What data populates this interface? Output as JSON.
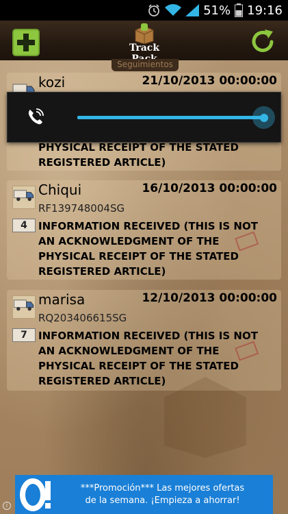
{
  "status_bar": {
    "battery": "51%",
    "time": "19:16",
    "alarm_icon": "alarm-clock-icon",
    "wifi_icon": "wifi-icon",
    "signal_icon": "signal-bars-icon",
    "battery_icon": "battery-icon"
  },
  "action_bar": {
    "title": "Track Pack",
    "subtitle": "Seguimientos",
    "add_icon": "plus-icon",
    "refresh_icon": "refresh-icon"
  },
  "items": [
    {
      "name": "kozi",
      "date": "21/10/2013 00:00:00",
      "status_visible": "PHYSICAL RECEIPT OF THE STATED\nREGISTERED ARTICLE)"
    },
    {
      "name": "Chiqui",
      "date": "16/10/2013 00:00:00",
      "code": "RF139748004SG",
      "count": "4",
      "status": "INFORMATION RECEIVED (THIS IS NOT AN ACKNOWLEDGMENT OF THE PHYSICAL RECEIPT OF THE STATED REGISTERED ARTICLE)"
    },
    {
      "name": "marisa",
      "date": "12/10/2013 00:00:00",
      "code": "RQ203406615SG",
      "count": "7",
      "status": "INFORMATION RECEIVED (THIS IS NOT AN ACKNOWLEDGMENT OF THE PHYSICAL RECEIPT OF THE STATED REGISTERED ARTICLE)"
    }
  ],
  "volume_overlay": {
    "icon": "phone-call-icon",
    "level": 1.0,
    "accent": "#33b5e5"
  },
  "ad": {
    "line1": "***Promoción*** Las mejores ofertas",
    "line2": "de la semana. ¡Empieza a ahorrar!",
    "info": "i"
  },
  "colors": {
    "add_button": "#8dc63f",
    "refresh": "#8dc63f",
    "ad_background": "#1a7fd6"
  }
}
